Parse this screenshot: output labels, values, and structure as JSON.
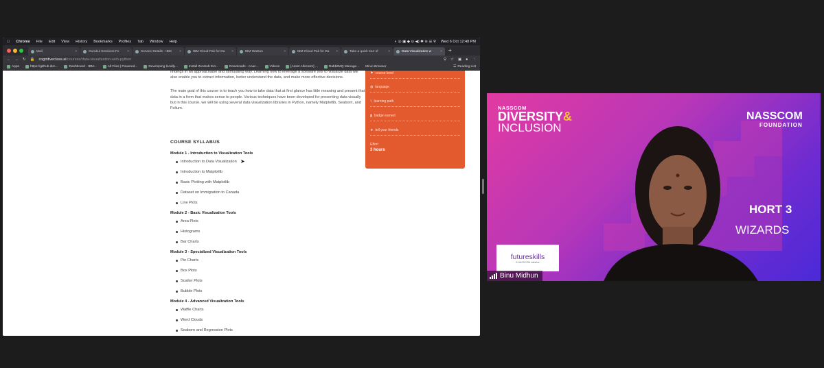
{
  "menubar": {
    "apple": "",
    "app": "Chrome",
    "items": [
      "File",
      "Edit",
      "View",
      "History",
      "Bookmarks",
      "Profiles",
      "Tab",
      "Window",
      "Help"
    ],
    "clock": "Wed 6 Oct  12:48 PM"
  },
  "tabs": [
    {
      "label": "Mail",
      "active": false
    },
    {
      "label": "Gurukul Sessions Fe",
      "active": false
    },
    {
      "label": "Service Details - IBM",
      "active": false
    },
    {
      "label": "IBM Cloud Pak for Da",
      "active": false
    },
    {
      "label": "IBM Watson",
      "active": false
    },
    {
      "label": "IBM Cloud Pak for Da",
      "active": false
    },
    {
      "label": "Take a quick tour of",
      "active": false
    },
    {
      "label": "Data Visualization w",
      "active": true
    }
  ],
  "address": {
    "domain": "cognitiveclass.ai",
    "path": "/courses/data-visualization-with-python"
  },
  "bookmarks": [
    "Apps",
    "https://github.ibm...",
    "Dashboard - IBM...",
    "All Files | Powered...",
    "Developing locally...",
    "Install ZenHub Ext...",
    "Downloads - Anac...",
    "Videos",
    "[Asset Allocator] ...",
    "RabbitMQ Manage...",
    "Minio Browser"
  ],
  "reading_list": "Reading List",
  "course": {
    "intro_p1": "findings in an approachable and stimulating way. Learning how to leverage a software tool to visualize data will also enable you to extract information, better understand the data, and make more effective decisions.",
    "intro_p2": "The main goal of this course is to teach you how to take data that at first glance has little meaning and present that data in a form that makes sense to people. Various techniques have been developed for presenting data visually but in this course, we will be using several data visualization libraries in Python, namely Matplotlib, Seaborn, and Folium.",
    "syllabus_heading": "COURSE SYLLABUS",
    "modules": [
      {
        "title": "Module 1 - Introduction to Visualization Tools",
        "items": [
          "Introduction to Data Visualization",
          "Introduction to Matplotlib",
          "Basic Plotting with Matplotlib",
          "Dataset on Immigration to Canada",
          "Line Plots"
        ]
      },
      {
        "title": "Module 2 - Basic Visualization Tools",
        "items": [
          "Area Plots",
          "Histograms",
          "Bar Charts"
        ]
      },
      {
        "title": "Module 3 - Specialized Visualization Tools",
        "items": [
          "Pie Charts",
          "Box Plots",
          "Scatter Plots",
          "Bubble Plots"
        ]
      },
      {
        "title": "Module 4 - Advanced Visualization Tools",
        "items": [
          "Waffle Charts",
          "Word Clouds",
          "Seaborn and Regression Plots"
        ]
      }
    ]
  },
  "sidebar": {
    "rows": [
      "course level",
      "language",
      "learning path",
      "badge earned",
      "tell your friends"
    ],
    "effort_label": "Effort",
    "effort_value": "3 hours"
  },
  "video": {
    "nasscom": "NASSCOM",
    "diversity": "DIVERSITY",
    "amp": "&",
    "inclusion": "INCLUSION",
    "foundation_a": "NASSCOM",
    "foundation_b": "FOUNDATION",
    "cohort": "HORT 3",
    "wizards": "WIZARDS",
    "futureskills": "futureskills",
    "futureskills_sub": "A NASSCOM initiative",
    "speaker": "Binu Midhun",
    "colors": {
      "pink": "#e23aa2",
      "purple": "#6e2bd1",
      "orange_panel": "#e35a2f"
    }
  }
}
